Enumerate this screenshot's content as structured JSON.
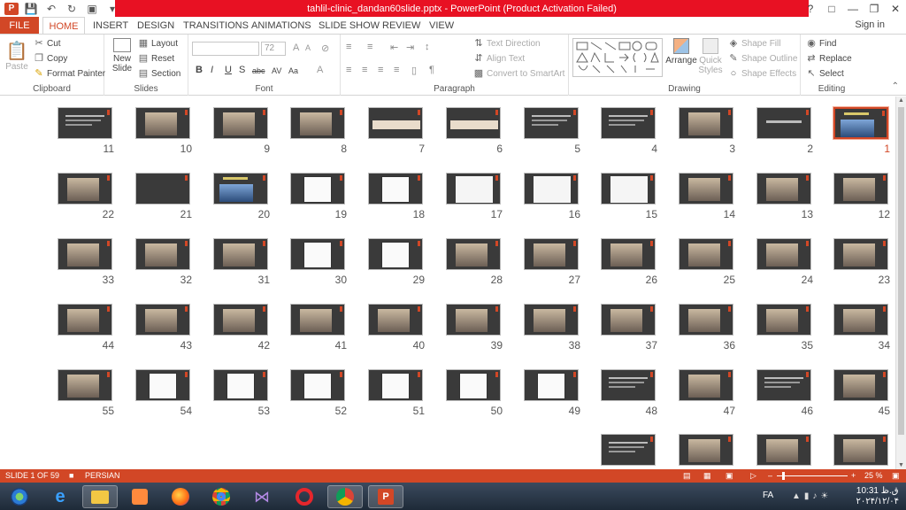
{
  "window": {
    "title": "tahlil-clinic_dandan60slide.pptx - PowerPoint (Product Activation Failed)",
    "help": "?",
    "sign_in": "Sign in"
  },
  "tabs": [
    "FILE",
    "HOME",
    "INSERT",
    "DESIGN",
    "TRANSITIONS",
    "ANIMATIONS",
    "SLIDE SHOW",
    "REVIEW",
    "VIEW"
  ],
  "ribbon": {
    "clipboard": {
      "label": "Clipboard",
      "paste": "Paste",
      "cut": "Cut",
      "copy": "Copy",
      "format_painter": "Format Painter"
    },
    "slides": {
      "label": "Slides",
      "new_slide": "New",
      "new_slide2": "Slide",
      "layout": "Layout",
      "reset": "Reset",
      "section": "Section"
    },
    "font": {
      "label": "Font",
      "size": "72"
    },
    "paragraph": {
      "label": "Paragraph",
      "text_direction": "Text Direction",
      "align_text": "Align Text",
      "convert_smartart": "Convert to SmartArt"
    },
    "drawing": {
      "label": "Drawing",
      "arrange": "Arrange",
      "quick_styles": "Quick",
      "quick_styles2": "Styles",
      "shape_fill": "Shape Fill",
      "shape_outline": "Shape Outline",
      "shape_effects": "Shape Effects"
    },
    "editing": {
      "label": "Editing",
      "find": "Find",
      "replace": "Replace",
      "select": "Select"
    }
  },
  "slides": [
    {
      "n": "1",
      "kind": "photo-title",
      "sel": true
    },
    {
      "n": "2",
      "kind": "title"
    },
    {
      "n": "3",
      "kind": "photo"
    },
    {
      "n": "4",
      "kind": "text"
    },
    {
      "n": "5",
      "kind": "text"
    },
    {
      "n": "6",
      "kind": "strip"
    },
    {
      "n": "7",
      "kind": "strip"
    },
    {
      "n": "8",
      "kind": "photo"
    },
    {
      "n": "9",
      "kind": "photo"
    },
    {
      "n": "10",
      "kind": "photo"
    },
    {
      "n": "11",
      "kind": "text"
    },
    {
      "n": "12",
      "kind": "photo"
    },
    {
      "n": "13",
      "kind": "photo"
    },
    {
      "n": "14",
      "kind": "photo"
    },
    {
      "n": "15",
      "kind": "drawing"
    },
    {
      "n": "16",
      "kind": "drawing"
    },
    {
      "n": "17",
      "kind": "drawing"
    },
    {
      "n": "18",
      "kind": "plan"
    },
    {
      "n": "19",
      "kind": "plan"
    },
    {
      "n": "20",
      "kind": "photo-title"
    },
    {
      "n": "21",
      "kind": "blank"
    },
    {
      "n": "22",
      "kind": "photo"
    },
    {
      "n": "23",
      "kind": "photo"
    },
    {
      "n": "24",
      "kind": "photo"
    },
    {
      "n": "25",
      "kind": "photo"
    },
    {
      "n": "26",
      "kind": "photo"
    },
    {
      "n": "27",
      "kind": "photo"
    },
    {
      "n": "28",
      "kind": "photo"
    },
    {
      "n": "29",
      "kind": "plan"
    },
    {
      "n": "30",
      "kind": "plan"
    },
    {
      "n": "31",
      "kind": "photo"
    },
    {
      "n": "32",
      "kind": "photo"
    },
    {
      "n": "33",
      "kind": "photo"
    },
    {
      "n": "34",
      "kind": "photo"
    },
    {
      "n": "35",
      "kind": "photo"
    },
    {
      "n": "36",
      "kind": "photo"
    },
    {
      "n": "37",
      "kind": "photo"
    },
    {
      "n": "38",
      "kind": "photo"
    },
    {
      "n": "39",
      "kind": "photo"
    },
    {
      "n": "40",
      "kind": "photo"
    },
    {
      "n": "41",
      "kind": "photo"
    },
    {
      "n": "42",
      "kind": "photo"
    },
    {
      "n": "43",
      "kind": "photo"
    },
    {
      "n": "44",
      "kind": "photo"
    },
    {
      "n": "45",
      "kind": "photo"
    },
    {
      "n": "46",
      "kind": "text"
    },
    {
      "n": "47",
      "kind": "photo"
    },
    {
      "n": "48",
      "kind": "text"
    },
    {
      "n": "49",
      "kind": "plan"
    },
    {
      "n": "50",
      "kind": "plan"
    },
    {
      "n": "51",
      "kind": "plan"
    },
    {
      "n": "52",
      "kind": "plan"
    },
    {
      "n": "53",
      "kind": "plan"
    },
    {
      "n": "54",
      "kind": "plan"
    },
    {
      "n": "55",
      "kind": "photo"
    },
    {
      "n": "",
      "kind": "photo"
    },
    {
      "n": "",
      "kind": "photo"
    },
    {
      "n": "",
      "kind": "photo"
    },
    {
      "n": "",
      "kind": "text"
    }
  ],
  "status": {
    "slide": "SLIDE 1 OF 59",
    "language": "PERSIAN",
    "zoom": "25 %"
  },
  "taskbar": {
    "lang": "FA",
    "time": "10:31 ق.ظ",
    "date": "۲۰۲۴/۱۲/۰۴"
  },
  "colors": {
    "accent": "#d24726",
    "title_red": "#e81123",
    "thumb_bg": "#3a3a3a"
  }
}
